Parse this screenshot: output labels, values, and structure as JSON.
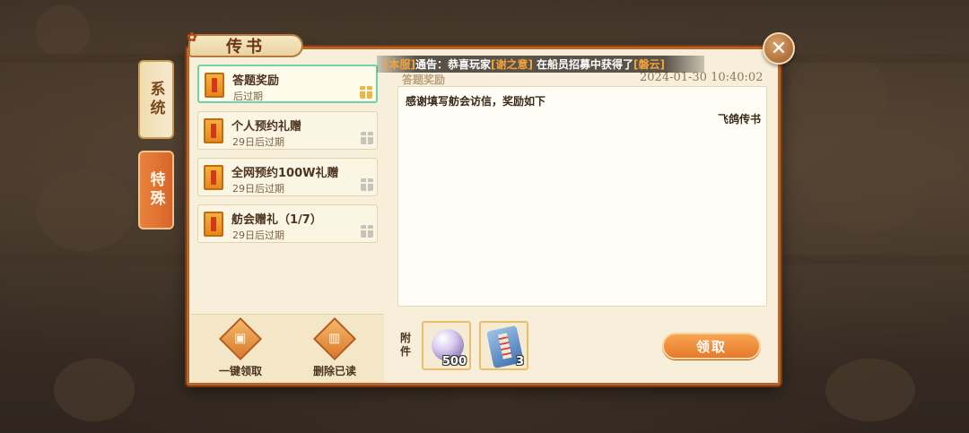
{
  "window": {
    "title": "传书"
  },
  "categories": [
    {
      "label": "系统",
      "selected": false
    },
    {
      "label": "特殊",
      "selected": true
    }
  ],
  "notice": {
    "prefix": "[本服]",
    "text1": "通告：恭喜玩家",
    "player": "[谢之意]",
    "text2": "在船员招募中获得了",
    "item": "[磐云]"
  },
  "mails": [
    {
      "title": "答题奖励",
      "subtitle": "后过期",
      "selected": true,
      "claimable": true
    },
    {
      "title": "个人预约礼赠",
      "subtitle": "29日后过期",
      "selected": false,
      "claimable": false
    },
    {
      "title": "全网预约100W礼赠",
      "subtitle": "29日后过期",
      "selected": false,
      "claimable": false
    },
    {
      "title": "舫会赠礼（1/7）",
      "subtitle": "29日后过期",
      "selected": false,
      "claimable": false
    }
  ],
  "list_actions": {
    "claim_all": "一键领取",
    "delete_read": "删除已读"
  },
  "detail": {
    "header_title": "答题奖励",
    "date": "2024-01-30  10:40:02",
    "body": "感谢填写舫会访信，奖励如下",
    "signature": "飞鸽传书"
  },
  "attachments": {
    "label": "附件",
    "items": [
      {
        "icon": "pearl-icon",
        "count": "500"
      },
      {
        "icon": "scroll-icon",
        "count": "3"
      }
    ]
  },
  "claim_button": "领取",
  "colors": {
    "accent": "#e57a2a",
    "panel_border": "#b9652a",
    "selected_outline": "#6fd2a8",
    "notice_highlight": "#f3a33a"
  }
}
